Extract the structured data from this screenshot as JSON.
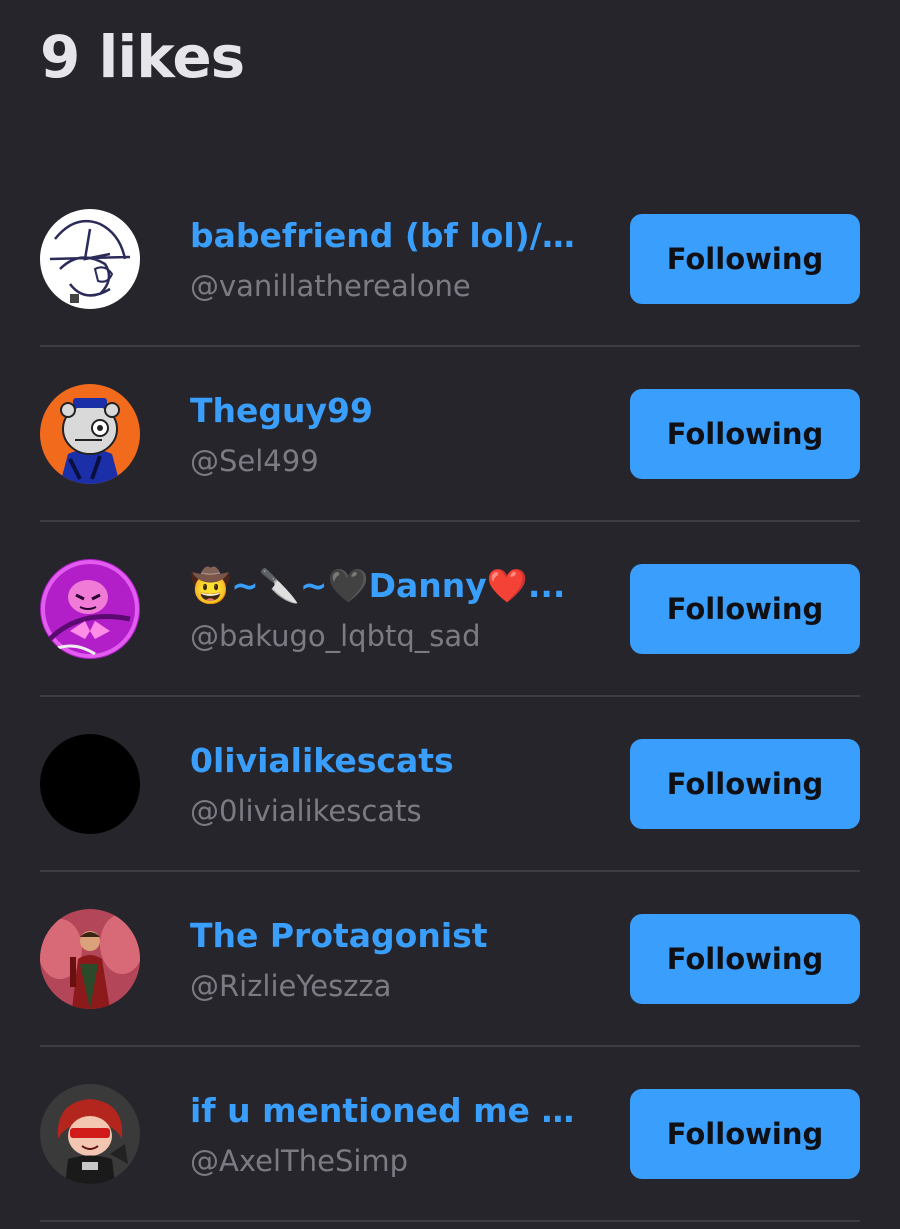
{
  "header": {
    "title": "9 likes"
  },
  "likes": [
    {
      "name": "babefriend (bf lol)/C...",
      "handle": "@vanillatherealone",
      "button": "Following"
    },
    {
      "name": "Theguy99",
      "handle": "@Sel499",
      "button": "Following"
    },
    {
      "name": "🤠~🔪~🖤Danny❤️...",
      "handle": "@bakugo_lqbtq_sad",
      "button": "Following"
    },
    {
      "name": "0livialikescats",
      "handle": "@0livialikescats",
      "button": "Following"
    },
    {
      "name": "The Protagonist",
      "handle": "@RizlieYeszza",
      "button": "Following"
    },
    {
      "name": "if u mentioned me in...",
      "handle": "@AxelTheSimp",
      "button": "Following"
    }
  ],
  "colors": {
    "background": "#26252b",
    "accent": "#3a9efc",
    "title": "#e6e6ea",
    "handle": "#7c7b84",
    "divider": "#3d3c44"
  }
}
